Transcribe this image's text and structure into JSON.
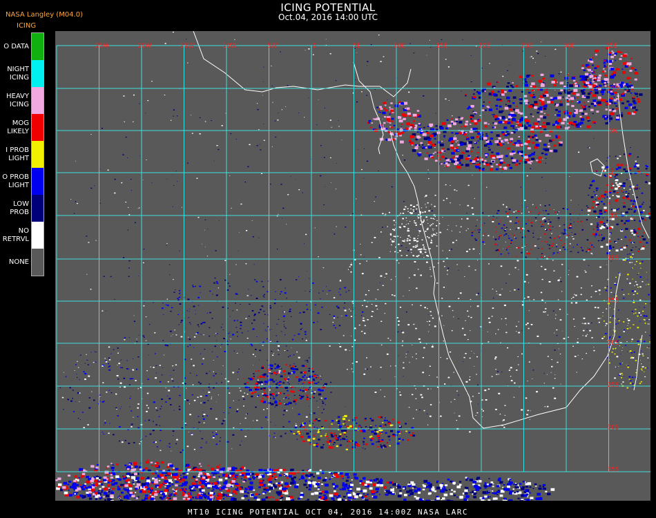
{
  "header": {
    "title": "ICING POTENTIAL",
    "subtitle": "Oct.04, 2016 14:00 UTC",
    "producer": "NASA Langley (M04.0)",
    "product": "ICING"
  },
  "legend": {
    "items": [
      {
        "label": "O DATA",
        "color": "#10b010"
      },
      {
        "label": "NIGHT\nICING",
        "color": "#00f0f0"
      },
      {
        "label": "HEAVY\nICING",
        "color": "#f0a8e0"
      },
      {
        "label": "MOG\nLIKELY",
        "color": "#f00000"
      },
      {
        "label": "I PROB\nLIGHT",
        "color": "#f0f000"
      },
      {
        "label": "O PROB\nLIGHT",
        "color": "#0000f0"
      },
      {
        "label": "LOW\nPROB",
        "color": "#00007a"
      },
      {
        "label": "NO\nRETRVL",
        "color": "#ffffff"
      },
      {
        "label": "NONE",
        "color": "#595959"
      }
    ]
  },
  "map": {
    "background_color": "#595959",
    "grid_color": "#40e0e0",
    "coast_color": "#ffffff",
    "lon_labels": [
      "25W",
      "20W",
      "15W",
      "10W",
      "5W",
      "0",
      "5E",
      "10E",
      "15E",
      "20E",
      "25E",
      "30E",
      "35E"
    ],
    "lat_labels": [
      "10N",
      "5N",
      "0",
      "5S",
      "10S",
      "15S",
      "20S",
      "25S",
      "30S",
      "35S",
      "40S",
      "45S"
    ]
  },
  "footer": {
    "text": "MT10  ICING POTENTIAL   OCT 04, 2016 14:00Z   NASA LARC"
  }
}
